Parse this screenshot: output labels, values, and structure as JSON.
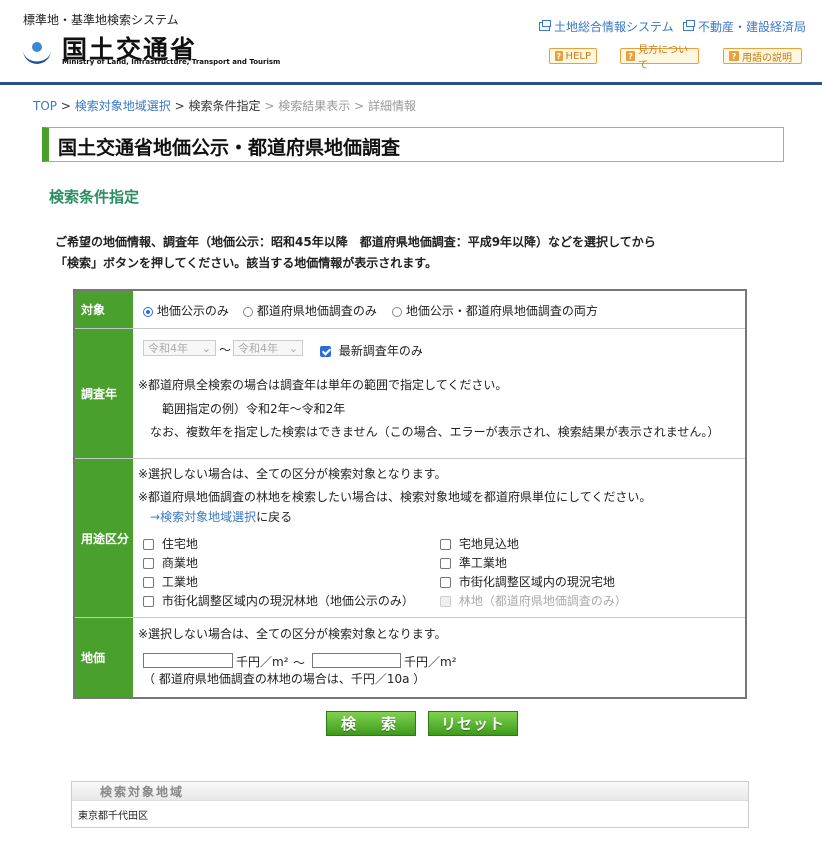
{
  "header": {
    "system_name": "標準地・基準地検索システム",
    "ministry_jp": "国土交通省",
    "ministry_en": "Ministry of Land, Infrastructure, Transport and Tourism",
    "links": [
      "土地総合情報システム",
      "不動産・建設経済局"
    ],
    "help_buttons": [
      "HELP",
      "見方について",
      "用語の説明"
    ]
  },
  "breadcrumb": {
    "top": "TOP",
    "sep": ">",
    "region_select": "検索対象地域選択",
    "conditions": "検索条件指定",
    "results": "検索結果表示",
    "details": "詳細情報"
  },
  "page_title": "国土交通省地価公示・都道府県地価調査",
  "section_title": "検索条件指定",
  "intro": [
    "ご希望の地価情報、調査年（地価公示：昭和45年以降　都道府県地価調査：平成9年以降）などを選択してから",
    "「検索」ボタンを押してください。該当する地価情報が表示されます。"
  ],
  "form": {
    "target": {
      "label": "対象",
      "options": [
        "地価公示のみ",
        "都道府県地価調査のみ",
        "地価公示・都道府県地価調査の両方"
      ],
      "selected": 0
    },
    "year": {
      "label": "調査年",
      "from": "令和4年",
      "range_sep": "～",
      "to": "令和4年",
      "latest_only_label": "最新調査年のみ",
      "latest_only_checked": true,
      "notes": [
        "※都道府県全検索の場合は調査年は単年の範囲で指定してください。",
        "範囲指定の例）令和2年～令和2年",
        "なお、複数年を指定した検索はできません（この場合、エラーが表示され、検索結果が表示されません。）"
      ]
    },
    "usage": {
      "label": "用途区分",
      "notes": [
        "※選択しない場合は、全ての区分が検索対象となります。",
        "※都道府県地価調査の林地を検索したい場合は、検索対象地域を都道府県単位にしてください。"
      ],
      "back_arrow": "→",
      "back_link": "検索対象地域選択",
      "back_suffix": "に戻る",
      "left_options": [
        "住宅地",
        "商業地",
        "工業地",
        "市街化調整区域内の現況林地（地価公示のみ）"
      ],
      "right_options": [
        "宅地見込地",
        "準工業地",
        "市街化調整区域内の現況宅地",
        "林地（都道府県地価調査のみ）"
      ]
    },
    "price": {
      "label": "地価",
      "note": "※選択しない場合は、全ての区分が検索対象となります。",
      "unit": "千円／m²",
      "range_sep": "～",
      "min_value": "",
      "max_value": "",
      "forest_note": "（ 都道府県地価調査の林地の場合は、千円／10a ）"
    }
  },
  "buttons": {
    "search": "検　索",
    "reset": "リセット"
  },
  "region": {
    "title": "検索対象地域",
    "value": "東京都千代田区"
  }
}
